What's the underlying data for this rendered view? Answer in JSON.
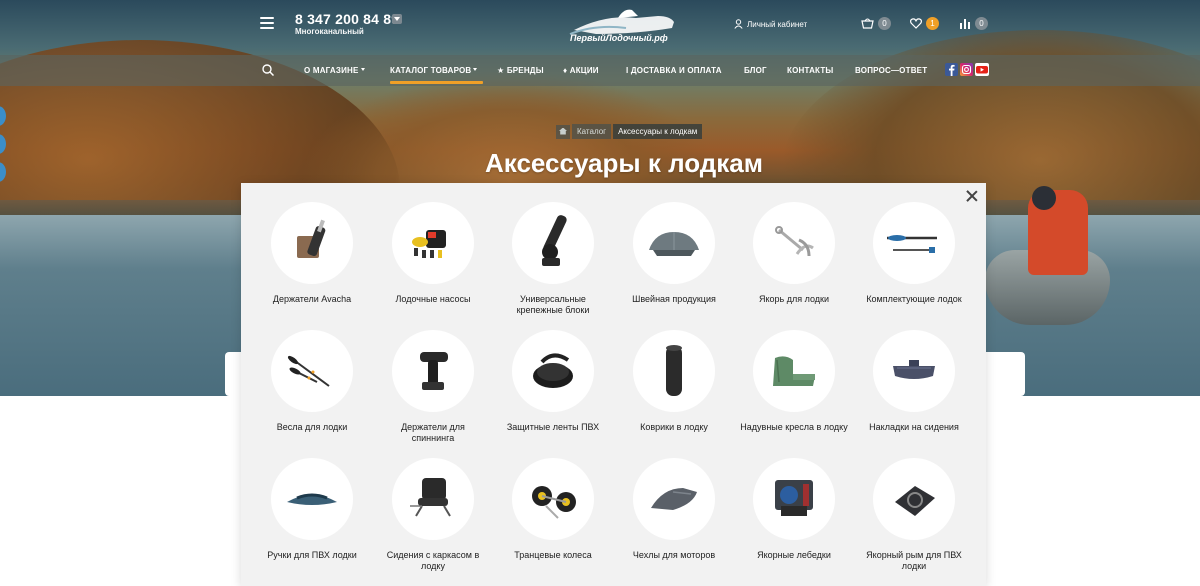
{
  "header": {
    "phone": "8 347 200 84 89",
    "phone_sub": "Многоканальный",
    "logo_text": "ПервыйЛодочный.рф",
    "account_label": "Личный кабинет",
    "cart_count": "0",
    "favorites_count": "1",
    "compare_count": "0"
  },
  "nav": {
    "items": [
      {
        "label": "О магазине"
      },
      {
        "label": "Каталог товаров"
      },
      {
        "label": "Бренды"
      },
      {
        "label": "Акции"
      },
      {
        "label": "Доставка и оплата"
      },
      {
        "label": "Блог"
      },
      {
        "label": "Контакты"
      },
      {
        "label": "Вопрос—ответ"
      }
    ],
    "brands_icon": "★",
    "promo_icon": "♦",
    "delivery_icon": "i"
  },
  "breadcrumb": {
    "catalog": "Каталог",
    "current": "Аксессуары к лодкам"
  },
  "page_title": "Аксессуары к лодкам",
  "categories": [
    {
      "label": "Держатели Avacha",
      "icon": "rod-holder-icon"
    },
    {
      "label": "Лодочные насосы",
      "icon": "pump-icon"
    },
    {
      "label": "Универсальные крепежные блоки",
      "icon": "mount-block-icon"
    },
    {
      "label": "Швейная продукция",
      "icon": "tent-icon"
    },
    {
      "label": "Якорь для лодки",
      "icon": "anchor-icon"
    },
    {
      "label": "Комплектующие лодок",
      "icon": "oar-part-icon"
    },
    {
      "label": "Весла для лодки",
      "icon": "oars-icon"
    },
    {
      "label": "Держатели для спиннинга",
      "icon": "spinning-holder-icon"
    },
    {
      "label": "Защитные ленты ПВХ",
      "icon": "tape-roll-icon"
    },
    {
      "label": "Коврики в лодку",
      "icon": "mat-roll-icon"
    },
    {
      "label": "Надувные кресла в лодку",
      "icon": "inflatable-seat-icon"
    },
    {
      "label": "Накладки на сидения",
      "icon": "seat-pad-icon"
    },
    {
      "label": "Ручки для ПВХ лодки",
      "icon": "handle-icon"
    },
    {
      "label": "Сидения с каркасом в лодку",
      "icon": "frame-seat-icon"
    },
    {
      "label": "Транцевые колеса",
      "icon": "transom-wheels-icon"
    },
    {
      "label": "Чехлы для моторов",
      "icon": "motor-cover-icon"
    },
    {
      "label": "Якорные лебедки",
      "icon": "winch-icon"
    },
    {
      "label": "Якорный рым для ПВХ лодки",
      "icon": "ring-mount-icon"
    }
  ],
  "colors": {
    "accent": "#f0a027",
    "panel_bg": "#f2f2f2",
    "badge_grey": "#7f8b92"
  }
}
